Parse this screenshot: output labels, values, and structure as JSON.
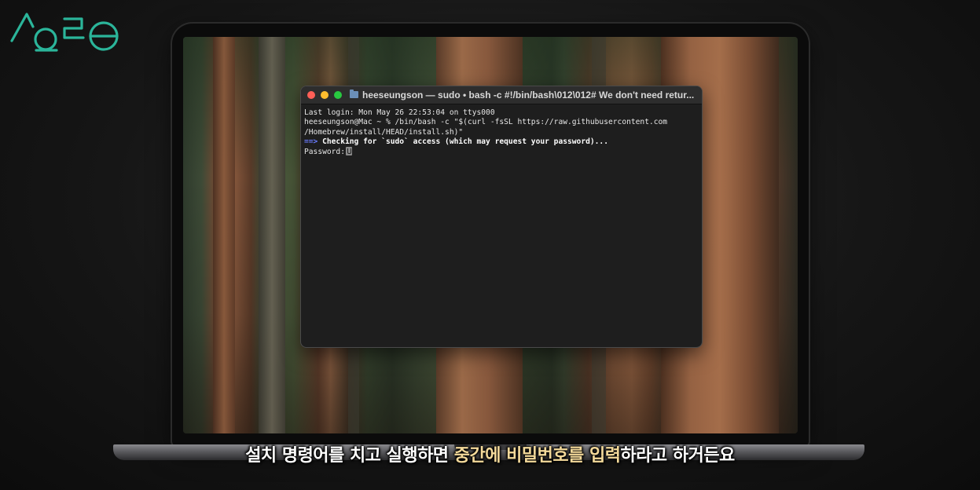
{
  "logo": {
    "icon": "channel-logo",
    "color": "#2bb59a"
  },
  "terminal": {
    "title": "heeseungson — sudo • bash -c #!/bin/bash\\012\\012# We don't need retur...",
    "lines": {
      "last_login": "Last login: Mon May 26 22:53:04 on ttys000",
      "command_1": "heeseungson@Mac ~ % /bin/bash -c \"$(curl -fsSL https://raw.githubusercontent.com",
      "command_2": "/Homebrew/install/HEAD/install.sh)\"",
      "check_arrow": "==>",
      "check_text": " Checking for `sudo` access (which may request your password)...",
      "password_prompt": "Password:"
    },
    "colors": {
      "background": "#1e1e1e",
      "arrow": "#6a7bff",
      "text": "#e6e6e6"
    }
  },
  "subtitle": {
    "part1": "설치 명령어를 치고 실행하면 ",
    "highlight": "중간에 비밀번호를 입력",
    "part2": "하라고 하거든요",
    "highlight_color": "#f3d99a"
  }
}
